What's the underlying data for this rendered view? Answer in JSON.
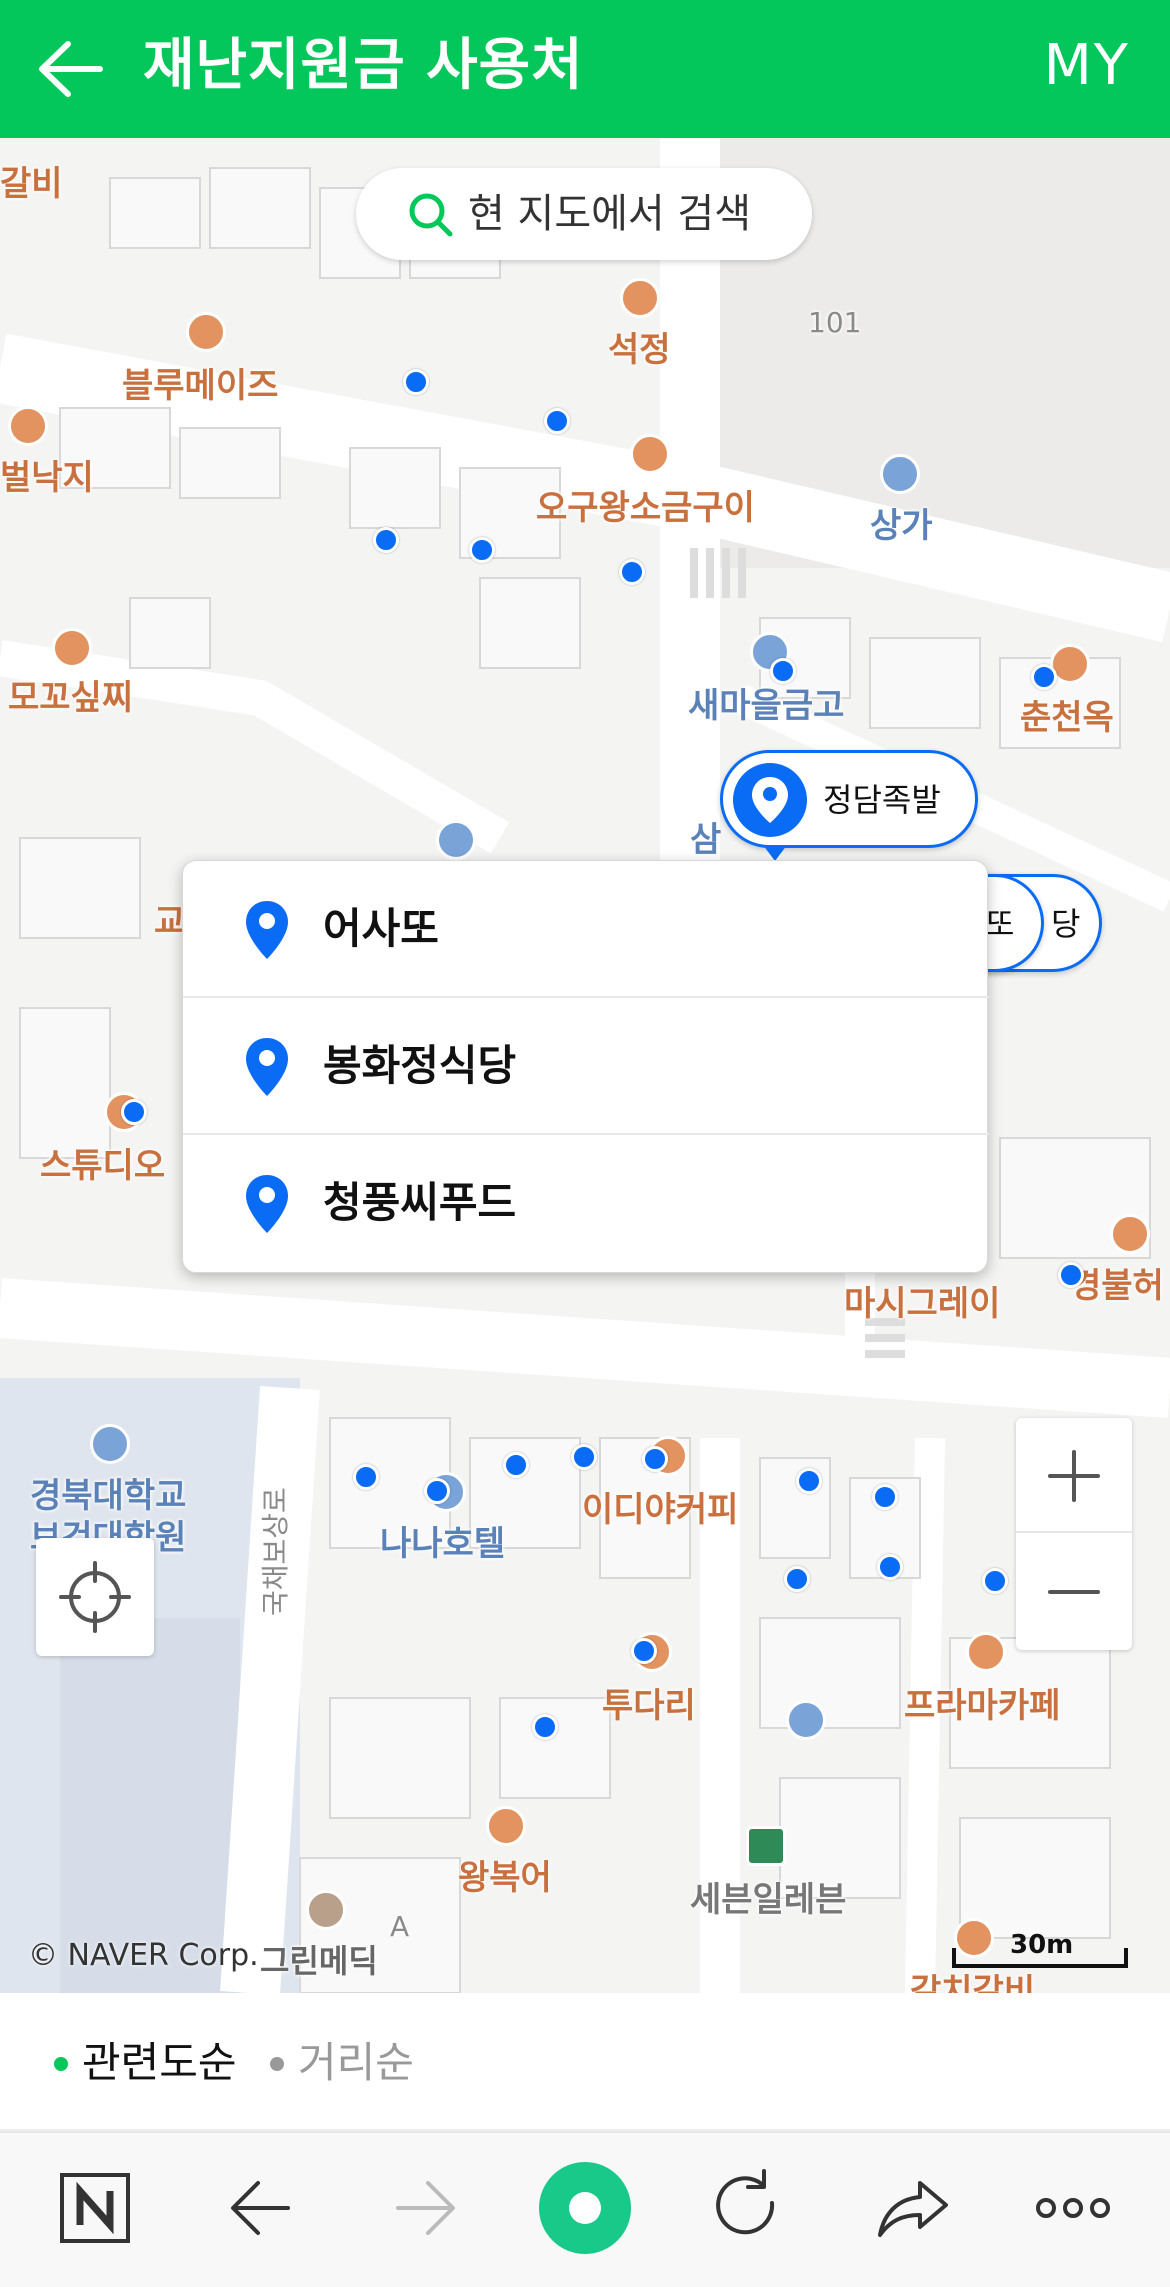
{
  "header": {
    "title": "재난지원금 사용처",
    "right_label": "MY",
    "background_color": "#03c75a"
  },
  "map": {
    "search_button_label": "현 지도에서 검색",
    "pois": [
      {
        "label": "갈비",
        "style": "orange"
      },
      {
        "label": "블루메이즈",
        "style": "orange"
      },
      {
        "label": "석정",
        "style": "orange"
      },
      {
        "label": "101",
        "style": "gray"
      },
      {
        "label": "벌낙지",
        "style": "orange"
      },
      {
        "label": "오구왕소금구이",
        "style": "orange"
      },
      {
        "label": "상가",
        "style": "blue"
      },
      {
        "label": "모꼬싶찌",
        "style": "orange"
      },
      {
        "label": "새마을금고",
        "style": "blue"
      },
      {
        "label": "춘천옥",
        "style": "orange"
      },
      {
        "label": "삼",
        "style": "blue"
      },
      {
        "label": "교",
        "style": "orange"
      },
      {
        "label": "스튜디오",
        "style": "orange"
      },
      {
        "label": "마시그레이",
        "style": "orange"
      },
      {
        "label": "경불허",
        "style": "orange"
      },
      {
        "label": "경북대학교",
        "style": "blue"
      },
      {
        "label": "보건대학원",
        "style": "blue"
      },
      {
        "label": "나나호텔",
        "style": "blue"
      },
      {
        "label": "이디야커피",
        "style": "orange"
      },
      {
        "label": "국채보상로",
        "style": "gray"
      },
      {
        "label": "투다리",
        "style": "orange"
      },
      {
        "label": "프라마카페",
        "style": "orange"
      },
      {
        "label": "왕복어",
        "style": "orange"
      },
      {
        "label": "세븐일레븐",
        "style": "gray"
      },
      {
        "label": "그린메딕",
        "style": "gray"
      },
      {
        "label": "A",
        "style": "gray"
      },
      {
        "label": "갈치갈비",
        "style": "orange"
      }
    ],
    "selected_pin": {
      "label": "정담족발",
      "color": "#0a6cf5"
    },
    "stacked_pins": [
      "또",
      "당"
    ],
    "popup_items": [
      {
        "name": "어사또"
      },
      {
        "name": "봉화정식당"
      },
      {
        "name": "청풍씨푸드"
      }
    ],
    "copyright": "© NAVER Corp.",
    "scale_label": "30m",
    "zoom_in": "+",
    "zoom_out": "−"
  },
  "sort_bar": {
    "options": [
      {
        "label": "관련도순",
        "active": true,
        "color": "#03c75a"
      },
      {
        "label": "거리순",
        "active": false,
        "color": "#999999"
      }
    ]
  },
  "bottom_nav": {
    "items": [
      {
        "name": "naver-home",
        "icon": "n-logo-icon",
        "enabled": true
      },
      {
        "name": "back",
        "icon": "arrow-left-icon",
        "enabled": true
      },
      {
        "name": "forward",
        "icon": "arrow-right-icon",
        "enabled": false
      },
      {
        "name": "green-dot",
        "icon": "green-dot-icon",
        "enabled": true
      },
      {
        "name": "refresh",
        "icon": "refresh-icon",
        "enabled": true
      },
      {
        "name": "share",
        "icon": "share-icon",
        "enabled": true
      },
      {
        "name": "more",
        "icon": "more-dots-icon",
        "enabled": true
      }
    ]
  }
}
